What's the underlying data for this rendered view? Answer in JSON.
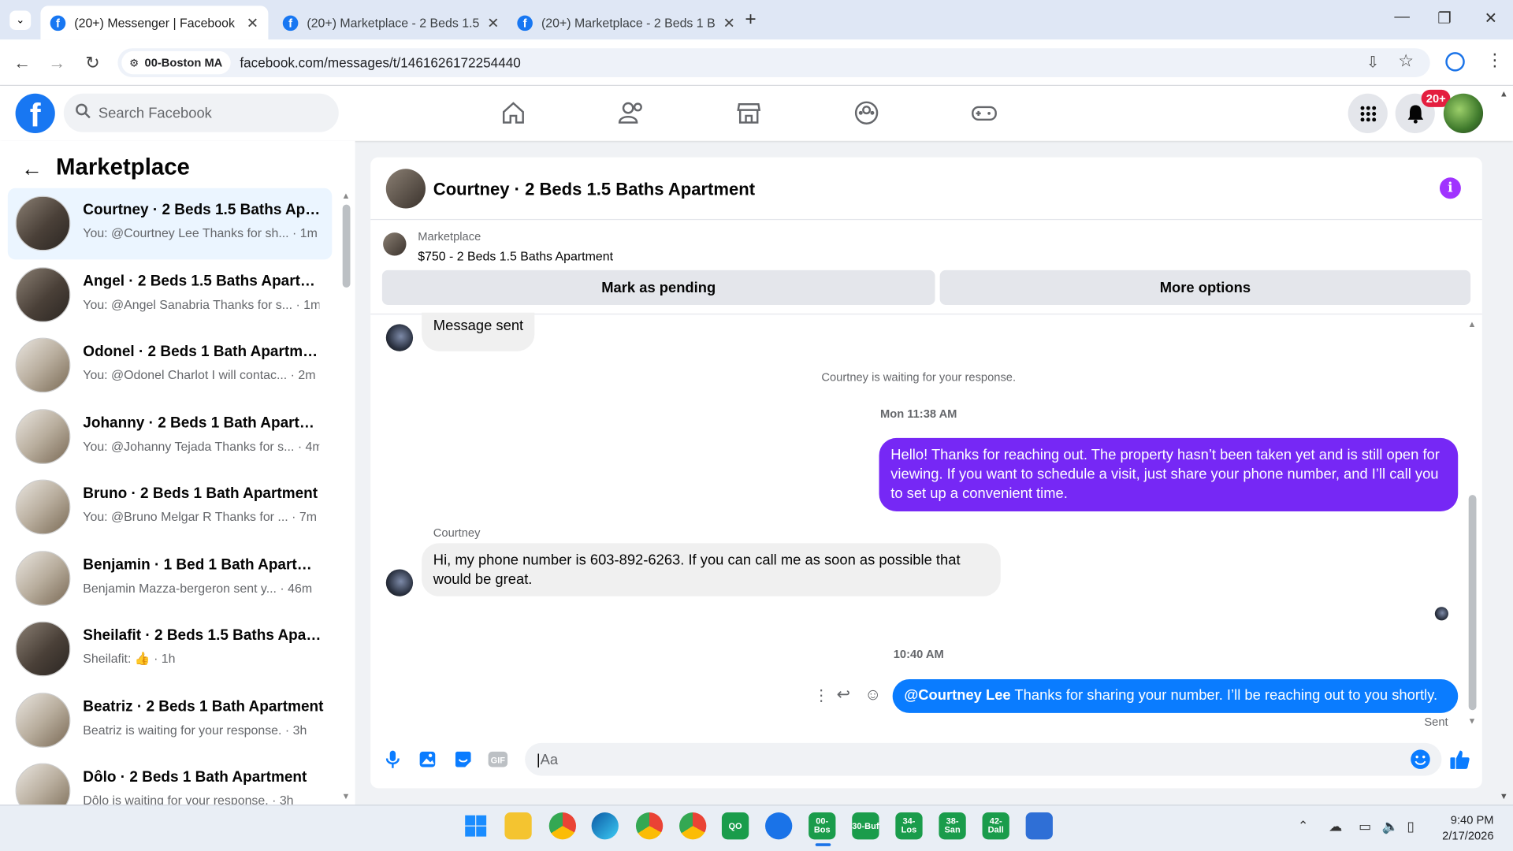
{
  "browser": {
    "tabs": [
      {
        "title": "(20+) Messenger | Facebook",
        "active": true
      },
      {
        "title": "(20+) Marketplace - 2 Beds 1.5",
        "active": false
      },
      {
        "title": "(20+) Marketplace - 2 Beds 1 B",
        "active": false
      }
    ],
    "site_chip": "00-Boston MA",
    "url": "facebook.com/messages/t/1461626172254440"
  },
  "fb_header": {
    "search_placeholder": "Search Facebook",
    "notification_badge": "20+"
  },
  "sidebar": {
    "title": "Marketplace",
    "conversations": [
      {
        "name": "Courtney · 2 Beds 1.5 Baths Apar...",
        "preview": "You: @Courtney Lee Thanks for sh...",
        "time": "· 1m",
        "selected": true
      },
      {
        "name": "Angel · 2 Beds 1.5 Baths Apartm...",
        "preview": "You: @Angel Sanabria Thanks for s...",
        "time": "· 1m"
      },
      {
        "name": "Odonel · 2 Beds 1 Bath Apartment",
        "preview": "You: @Odonel Charlot I will contac...",
        "time": "· 2m"
      },
      {
        "name": "Johanny · 2 Beds 1 Bath Apartm...",
        "preview": "You: @Johanny Tejada Thanks for s...",
        "time": "· 4m"
      },
      {
        "name": "Bruno · 2 Beds 1 Bath Apartment",
        "preview": "You: @Bruno Melgar R Thanks for ...",
        "time": "· 7m"
      },
      {
        "name": "Benjamin · 1 Bed 1 Bath Apartme...",
        "preview": "Benjamin Mazza-bergeron sent y...",
        "time": "· 46m"
      },
      {
        "name": "Sheilafit · 2 Beds 1.5 Baths Apart...",
        "preview": "Sheilafit:",
        "time": "· 1h"
      },
      {
        "name": "Beatriz · 2 Beds 1 Bath Apartment",
        "preview": "Beatriz is waiting for your response.",
        "time": "· 3h"
      },
      {
        "name": "Dôlo · 2 Beds 1 Bath Apartment",
        "preview": "Dôlo is waiting for your response.",
        "time": "· 3h"
      }
    ]
  },
  "chat": {
    "title": "Courtney · 2 Beds 1.5 Baths Apartment",
    "marketplace_label": "Marketplace",
    "listing": "$750 - 2 Beds 1.5 Baths Apartment",
    "mark_pending": "Mark as pending",
    "more_options": "More options",
    "messages": {
      "sent_notice": "Message sent",
      "waiting": "Courtney is waiting for your response.",
      "time1": "Mon 11:38 AM",
      "out1": "Hello! Thanks for reaching out. The property hasn’t been taken yet and is still open for viewing. If you want to schedule a visit, just share your phone number, and I’ll call you to set up a convenient time.",
      "sender": "Courtney",
      "in1": "Hi, my phone number is 603-892-6263. If you can call me as soon as possible that would be great.",
      "time2": "10:40 AM",
      "mention": "@Courtney Lee",
      "out2": " Thanks for sharing your number. I’ll be reaching out to you shortly.",
      "status": "Sent"
    },
    "composer_placeholder": "Aa"
  },
  "taskbar": {
    "apps": [
      "00-Bos",
      "30-Buf",
      "34-Los",
      "38-San",
      "42-Dall"
    ],
    "time": "9:40 PM",
    "date": "2/17/2026"
  },
  "colors": {
    "fb_blue": "#1877f2",
    "purple_bubble": "#7628f5",
    "blue_bubble": "#0a7cff"
  }
}
